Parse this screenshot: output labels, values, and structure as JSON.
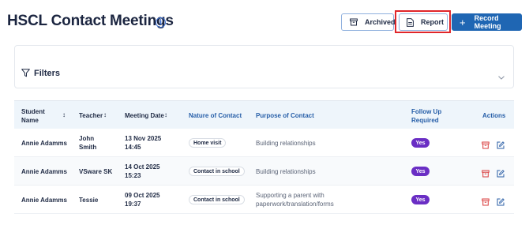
{
  "header": {
    "title": "HSCL Contact Meetings",
    "buttons": {
      "archived": "Archived",
      "report": "Report",
      "record": "Record Meeting"
    }
  },
  "filters": {
    "label": "Filters"
  },
  "table": {
    "columns": {
      "student": [
        "Student",
        "Name"
      ],
      "teacher": "Teacher",
      "date": "Meeting Date",
      "nature": "Nature of Contact",
      "purpose": "Purpose of Contact",
      "followup": [
        "Follow Up",
        "Required"
      ],
      "actions": "Actions"
    },
    "rows": [
      {
        "student": "Annie Adamms",
        "teacher": [
          "John",
          "Smith"
        ],
        "date": [
          "13 Nov 2025",
          "14:45"
        ],
        "nature": "Home visit",
        "purpose": [
          "Building relationships"
        ],
        "followup": "Yes"
      },
      {
        "student": "Annie Adamms",
        "teacher": [
          "VSware SK"
        ],
        "date": [
          "14 Oct 2025",
          "15:23"
        ],
        "nature": "Contact in school",
        "purpose": [
          "Building relationships"
        ],
        "followup": "Yes"
      },
      {
        "student": "Annie Adamms",
        "teacher": [
          "Tessie"
        ],
        "date": [
          "09 Oct 2025",
          "19:37"
        ],
        "nature": "Contact in school",
        "purpose": [
          "Supporting a parent with",
          "paperwork/translation/forms"
        ],
        "followup": "Yes"
      }
    ]
  },
  "colors": {
    "primary": "#1f66b3",
    "highlight": "#e0262a",
    "followup_badge": "#6a2ec4",
    "delete_icon": "#d93b3b",
    "edit_icon": "#2a5ea6",
    "header_bg": "#eef5fb"
  },
  "icons": {
    "info": "info-icon",
    "archive": "archive-icon",
    "report": "document-icon",
    "record": "plus-icon",
    "filter": "filter-icon",
    "expand": "chevron-down-icon",
    "delete": "trash-icon",
    "edit": "edit-icon"
  }
}
